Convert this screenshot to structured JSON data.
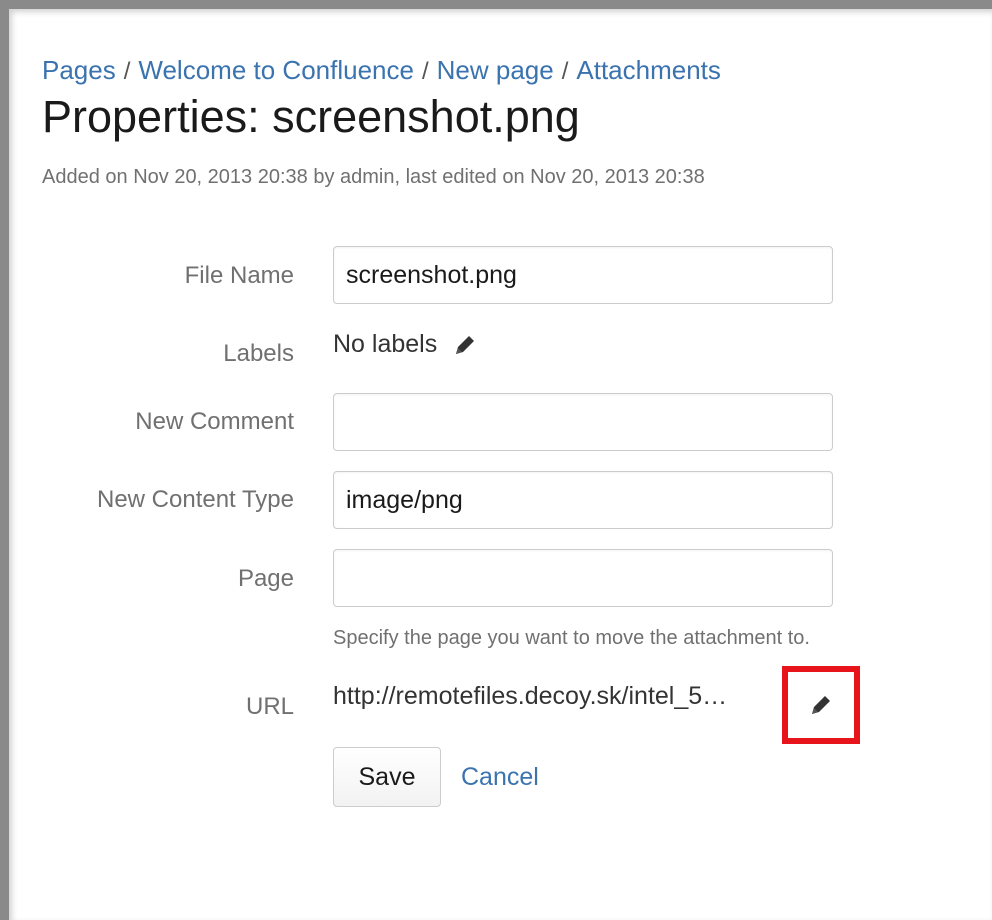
{
  "breadcrumb": {
    "items": [
      "Pages",
      "Welcome to Confluence",
      "New page",
      "Attachments"
    ],
    "separator": "/"
  },
  "title": "Properties: screenshot.png",
  "meta": "Added on Nov 20, 2013 20:38 by admin, last edited on Nov 20, 2013 20:38",
  "form": {
    "file_name": {
      "label": "File Name",
      "value": "screenshot.png"
    },
    "labels": {
      "label": "Labels",
      "value": "No labels",
      "edit_icon": "pencil-icon"
    },
    "new_comment": {
      "label": "New Comment",
      "value": ""
    },
    "new_content_type": {
      "label": "New Content Type",
      "value": "image/png"
    },
    "page": {
      "label": "Page",
      "value": "",
      "hint": "Specify the page you want to move the attachment to."
    },
    "url": {
      "label": "URL",
      "value": "http://remotefiles.decoy.sk/intel_5…",
      "edit_icon": "pencil-icon"
    }
  },
  "actions": {
    "save_label": "Save",
    "cancel_label": "Cancel"
  },
  "colors": {
    "link": "#3b73af",
    "highlight": "#e8141c",
    "muted_text": "#707070"
  }
}
